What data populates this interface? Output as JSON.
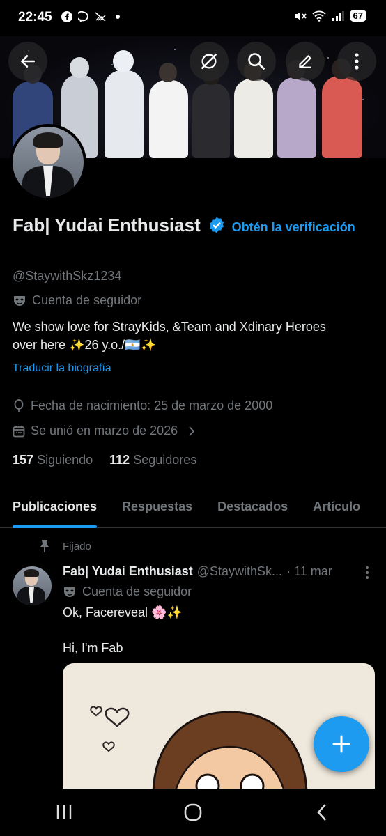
{
  "status_bar": {
    "time": "22:45",
    "battery": "67"
  },
  "profile": {
    "display_name": "Fab| Yudai Enthusiast",
    "verify_cta": "Obtén la verificación",
    "handle": "@StaywithSkz1234",
    "account_type": "Cuenta de seguidor",
    "bio_line1": "We show love for StrayKids, &Team and Xdinary Heroes",
    "bio_line2": "over here ✨26 y.o./🇦🇷✨",
    "translate_label": "Traducir la biografía",
    "birthdate": "Fecha de nacimiento: 25 de marzo de 2000",
    "joined": "Se unió en marzo de 2026",
    "following_count": "157",
    "following_label": "Siguiendo",
    "followers_count": "112",
    "followers_label": "Seguidores"
  },
  "tabs": [
    {
      "label": "Publicaciones",
      "active": true
    },
    {
      "label": "Respuestas",
      "active": false
    },
    {
      "label": "Destacados",
      "active": false
    },
    {
      "label": "Artículo",
      "active": false
    }
  ],
  "post": {
    "pinned_label": "Fijado",
    "author_name": "Fab| Yudai Enthusiast",
    "author_handle": "@StaywithSk...",
    "date": "· 11 mar",
    "account_type": "Cuenta de seguidor",
    "text_line1": "Ok, Facereveal 🌸✨",
    "text_line2": "Hi, I'm Fab"
  },
  "colors": {
    "accent": "#1d9bf0",
    "muted": "#71767b",
    "text": "#e7e9ea",
    "divider": "#2f3336"
  },
  "icons": {
    "back": "back-arrow-icon",
    "grok": "grok-icon",
    "search": "search-icon",
    "edit": "edit-icon",
    "more": "more-vertical-icon",
    "verified": "verified-badge-icon",
    "mask": "mask-icon",
    "balloon": "balloon-icon",
    "calendar": "calendar-icon",
    "pin": "pin-icon",
    "compose": "plus-icon"
  }
}
